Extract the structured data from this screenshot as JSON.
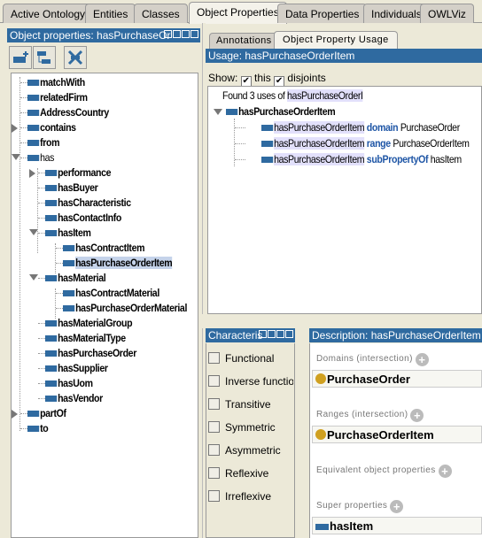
{
  "tabs": [
    "Active Ontology",
    "Entities",
    "Classes",
    "Object Properties",
    "Data Properties",
    "Individuals",
    "OWLViz"
  ],
  "active_tab": "Object Properties",
  "left": {
    "header": "Object properties: hasPurchaseOr",
    "tree": [
      {
        "label": "matchWith",
        "level": 0,
        "toggle": "none"
      },
      {
        "label": "relatedFirm",
        "level": 0,
        "toggle": "none"
      },
      {
        "label": "AddressCountry",
        "level": 0,
        "toggle": "none"
      },
      {
        "label": "contains",
        "level": 0,
        "toggle": "collapsed"
      },
      {
        "label": "from",
        "level": 0,
        "toggle": "none"
      },
      {
        "label": "has",
        "level": 0,
        "toggle": "expanded",
        "plain": true
      },
      {
        "label": "performance",
        "level": 1,
        "toggle": "collapsed"
      },
      {
        "label": "hasBuyer",
        "level": 1,
        "toggle": "none"
      },
      {
        "label": "hasCharacteristic",
        "level": 1,
        "toggle": "none"
      },
      {
        "label": "hasContactInfo",
        "level": 1,
        "toggle": "none"
      },
      {
        "label": "hasItem",
        "level": 1,
        "toggle": "expanded"
      },
      {
        "label": "hasContractItem",
        "level": 2,
        "toggle": "none"
      },
      {
        "label": "hasPurchaseOrderItem",
        "level": 2,
        "toggle": "none",
        "selected": true
      },
      {
        "label": "hasMaterial",
        "level": 1,
        "toggle": "expanded"
      },
      {
        "label": "hasContractMaterial",
        "level": 2,
        "toggle": "none"
      },
      {
        "label": "hasPurchaseOrderMaterial",
        "level": 2,
        "toggle": "none"
      },
      {
        "label": "hasMaterialGroup",
        "level": 1,
        "toggle": "none"
      },
      {
        "label": "hasMaterialType",
        "level": 1,
        "toggle": "none"
      },
      {
        "label": "hasPurchaseOrder",
        "level": 1,
        "toggle": "none"
      },
      {
        "label": "hasSupplier",
        "level": 1,
        "toggle": "none"
      },
      {
        "label": "hasUom",
        "level": 1,
        "toggle": "none"
      },
      {
        "label": "hasVendor",
        "level": 1,
        "toggle": "none"
      },
      {
        "label": "partOf",
        "level": 0,
        "toggle": "collapsed"
      },
      {
        "label": "to",
        "level": 0,
        "toggle": "none"
      }
    ]
  },
  "usage": {
    "subtabs": [
      "Annotations",
      "Object Property Usage"
    ],
    "active_subtab": "Object Property Usage",
    "header": "Usage: hasPurchaseOrderItem",
    "show_label": "Show:",
    "this_label": "this",
    "this_checked": true,
    "disjoints_label": "disjoints",
    "disjoints_checked": true,
    "found_prefix": "Found 3 uses of ",
    "found_name": "hasPurchaseOrderI",
    "root": "hasPurchaseOrderItem",
    "uses": [
      {
        "subject": "hasPurchaseOrderItem",
        "keyword": "domain",
        "object": "PurchaseOrder"
      },
      {
        "subject": "hasPurchaseOrderItem",
        "keyword": "range",
        "object": "PurchaseOrderItem"
      },
      {
        "subject": "hasPurchaseOrderItem",
        "keyword": "subPropertyOf",
        "object": "hasItem"
      }
    ]
  },
  "characteristics": {
    "header": "Characteris",
    "items": [
      {
        "label": "Functional",
        "checked": false
      },
      {
        "label": "Inverse functiona",
        "checked": false
      },
      {
        "label": "Transitive",
        "checked": false
      },
      {
        "label": "Symmetric",
        "checked": false
      },
      {
        "label": "Asymmetric",
        "checked": false
      },
      {
        "label": "Reflexive",
        "checked": false
      },
      {
        "label": "Irreflexive",
        "checked": false
      }
    ]
  },
  "description": {
    "header": "Description: hasPurchaseOrderItem",
    "domains_label": "Domains (intersection)",
    "domain": "PurchaseOrder",
    "ranges_label": "Ranges (intersection)",
    "range": "PurchaseOrderItem",
    "equivalent_label": "Equivalent object properties",
    "super_label": "Super properties",
    "super": "hasItem"
  },
  "colors": {
    "header": "#2f6aa0",
    "selection": "#c5d3ea",
    "class_dot": "#d0a020",
    "keyword": "#1f56a6"
  }
}
